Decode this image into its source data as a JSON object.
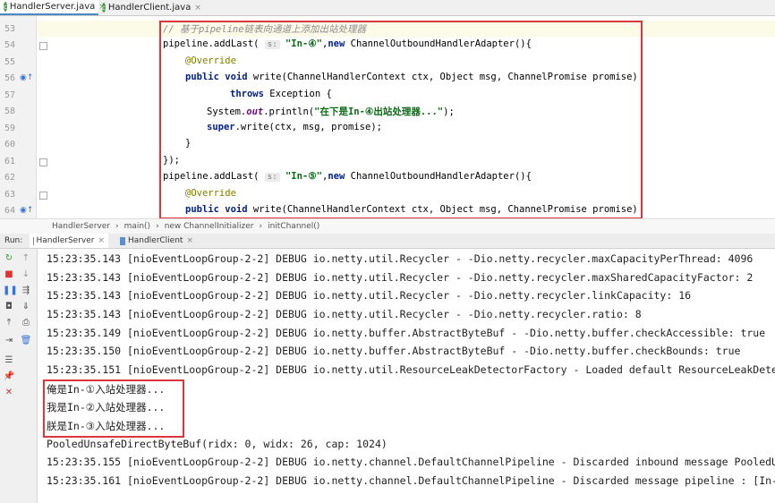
{
  "tabs": [
    {
      "label": "HandlerServer.java",
      "close": "×"
    },
    {
      "label": "HandlerClient.java",
      "close": "×"
    }
  ],
  "editor": {
    "line_numbers": [
      "53",
      "54",
      "55",
      "56",
      "57",
      "58",
      "59",
      "60",
      "61",
      "62",
      "63",
      "64"
    ],
    "lines": {
      "l53": {
        "comment": "// 基于pipeline链表向通道上添加出站处理器"
      },
      "l54": {
        "prefix": "pipeline.addLast(",
        "hint": "s:",
        "str": "\"In-④\"",
        "mid": ",",
        "kw": "new",
        "rest": " ChannelOutboundHandlerAdapter(){"
      },
      "l55": {
        "ann": "@Override"
      },
      "l56": {
        "kw1": "public",
        "kw2": "void",
        "rest": " write(ChannelHandlerContext ctx, Object msg, ChannelPromise promise)"
      },
      "l57": {
        "kw": "throws",
        "rest": " Exception {"
      },
      "l58": {
        "pre": "System.",
        "field": "out",
        "mid": ".println(",
        "str": "\"在下是In-④出站处理器...\"",
        "end": ");"
      },
      "l59": {
        "kw": "super",
        "rest": ".write(ctx, msg, promise);"
      },
      "l60": {
        "text": "}"
      },
      "l61": {
        "text": "});"
      },
      "l62": {
        "prefix": "pipeline.addLast(",
        "hint": "s:",
        "str": "\"In-⑤\"",
        "mid": ",",
        "kw": "new",
        "rest": " ChannelOutboundHandlerAdapter(){"
      },
      "l63": {
        "ann": "@Override"
      },
      "l64": {
        "kw1": "public",
        "kw2": "void",
        "rest": " write(ChannelHandlerContext ctx, Object msg, ChannelPromise promise)"
      }
    }
  },
  "breadcrumb": [
    "HandlerServer",
    "main()",
    "new ChannelInitializer",
    "initChannel()"
  ],
  "run": {
    "label": "Run:",
    "tabs": [
      {
        "label": "HandlerServer",
        "close": "×"
      },
      {
        "label": "HandlerClient",
        "close": "×"
      }
    ]
  },
  "console_lines": [
    "15:23:35.143 [nioEventLoopGroup-2-2] DEBUG io.netty.util.Recycler - -Dio.netty.recycler.maxCapacityPerThread: 4096",
    "15:23:35.143 [nioEventLoopGroup-2-2] DEBUG io.netty.util.Recycler - -Dio.netty.recycler.maxSharedCapacityFactor: 2",
    "15:23:35.143 [nioEventLoopGroup-2-2] DEBUG io.netty.util.Recycler - -Dio.netty.recycler.linkCapacity: 16",
    "15:23:35.143 [nioEventLoopGroup-2-2] DEBUG io.netty.util.Recycler - -Dio.netty.recycler.ratio: 8",
    "15:23:35.149 [nioEventLoopGroup-2-2] DEBUG io.netty.buffer.AbstractByteBuf - -Dio.netty.buffer.checkAccessible: true",
    "15:23:35.150 [nioEventLoopGroup-2-2] DEBUG io.netty.buffer.AbstractByteBuf - -Dio.netty.buffer.checkBounds: true",
    "15:23:35.151 [nioEventLoopGroup-2-2] DEBUG io.netty.util.ResourceLeakDetectorFactory - Loaded default ResourceLeakDete",
    "俺是In-①入站处理器...",
    "我是In-②入站处理器...",
    "朕是In-③入站处理器...",
    "PooledUnsafeDirectByteBuf(ridx: 0, widx: 26, cap: 1024)",
    "15:23:35.155 [nioEventLoopGroup-2-2] DEBUG io.netty.channel.DefaultChannelPipeline - Discarded inbound message PooledU",
    "15:23:35.161 [nioEventLoopGroup-2-2] DEBUG io.netty.channel.DefaultChannelPipeline - Discarded message pipeline : [In-"
  ],
  "colors": {
    "highlight_box": "#d9363e",
    "keyword": "#00218a",
    "string": "#096b14"
  }
}
